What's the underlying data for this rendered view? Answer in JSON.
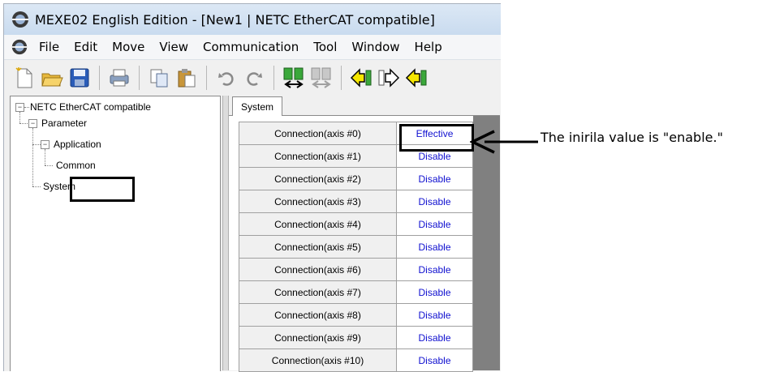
{
  "window": {
    "title": "MEXE02 English Edition - [New1 | NETC EtherCAT compatible]"
  },
  "menu": [
    "File",
    "Edit",
    "Move",
    "View",
    "Communication",
    "Tool",
    "Window",
    "Help"
  ],
  "toolbar": {
    "icons": [
      "new-file-icon",
      "open-folder-icon",
      "save-icon",
      "print-icon",
      "copy-icon",
      "paste-icon",
      "undo-icon",
      "redo-icon",
      "compare-data-icon",
      "compare-data-disabled-icon",
      "read-from-device-icon",
      "write-to-device-icon",
      "teaching-icon"
    ]
  },
  "tree": {
    "root": "NETC EtherCAT compatible",
    "parameter": "Parameter",
    "application": "Application",
    "common": "Common",
    "system": "System"
  },
  "tabs": [
    "System"
  ],
  "grid": {
    "rows": [
      {
        "name": "Connection(axis #0)",
        "value": "Effective"
      },
      {
        "name": "Connection(axis #1)",
        "value": "Disable"
      },
      {
        "name": "Connection(axis #2)",
        "value": "Disable"
      },
      {
        "name": "Connection(axis #3)",
        "value": "Disable"
      },
      {
        "name": "Connection(axis #4)",
        "value": "Disable"
      },
      {
        "name": "Connection(axis #5)",
        "value": "Disable"
      },
      {
        "name": "Connection(axis #6)",
        "value": "Disable"
      },
      {
        "name": "Connection(axis #7)",
        "value": "Disable"
      },
      {
        "name": "Connection(axis #8)",
        "value": "Disable"
      },
      {
        "name": "Connection(axis #9)",
        "value": "Disable"
      },
      {
        "name": "Connection(axis #10)",
        "value": "Disable"
      }
    ]
  },
  "annotation": {
    "text": "The inirila value is \"enable.\""
  },
  "colors": {
    "value_text": "#1010d0",
    "highlight": "#000000"
  }
}
